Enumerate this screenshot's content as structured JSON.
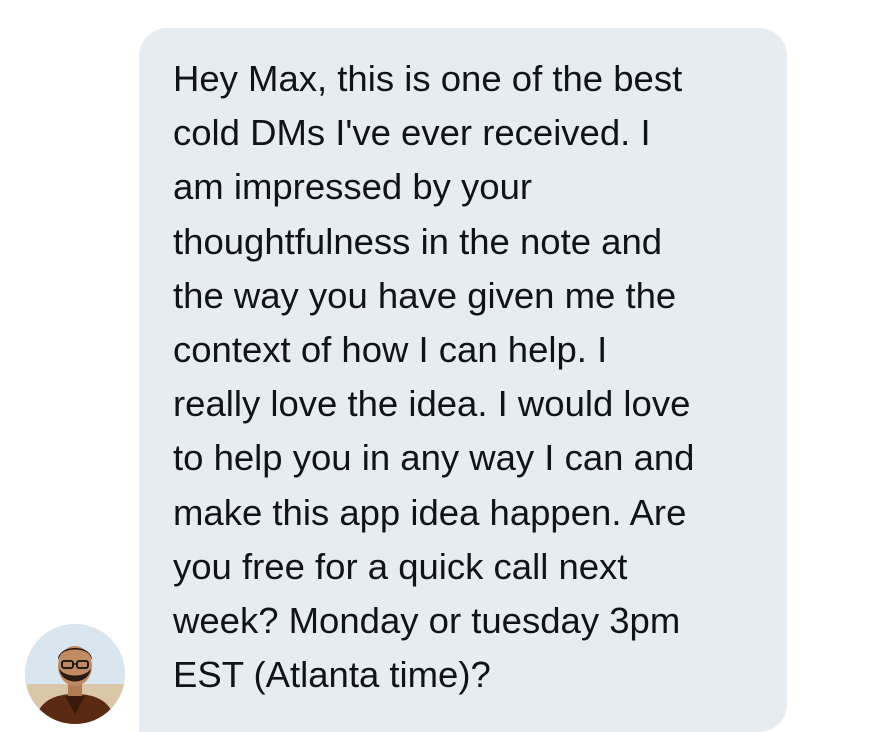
{
  "conversation": {
    "message": {
      "text": "Hey Max, this is one of the best\ncold DMs I've ever received. I\nam impressed by your\nthoughtfulness in the note and\nthe way you have given me the\ncontext of how I can help. I\nreally love the idea. I would love\nto help you in any way I can and\nmake this app idea happen. Are\nyou free for a quick call next\nweek? Monday or tuesday 3pm\nEST (Atlanta time)?",
      "bubble_color": "#e7ecf1",
      "text_color": "#101418"
    },
    "sender": {
      "avatar_icon": "user-avatar-photo"
    }
  }
}
